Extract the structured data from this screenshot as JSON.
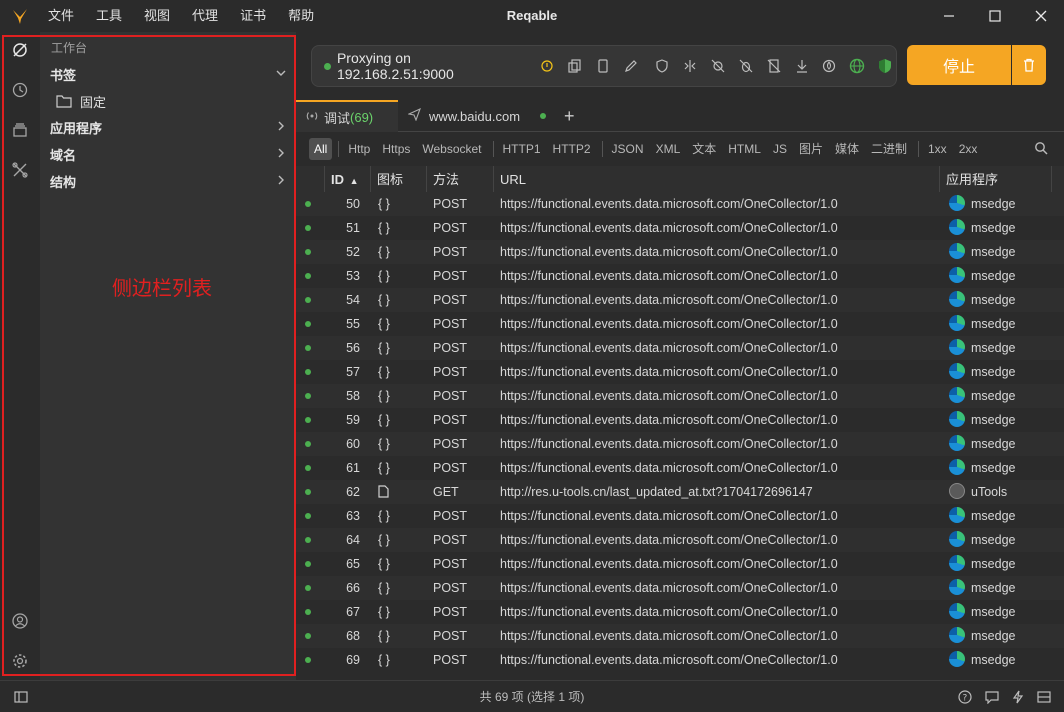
{
  "app": {
    "title": "Reqable"
  },
  "menu": [
    "文件",
    "工具",
    "视图",
    "代理",
    "证书",
    "帮助"
  ],
  "sidebar": {
    "title": "工作台",
    "bookmarks_label": "书签",
    "pinned_label": "固定",
    "apps_label": "应用程序",
    "domains_label": "域名",
    "structure_label": "结构"
  },
  "annotation": {
    "label": "侧边栏列表",
    "color": "#e02020"
  },
  "proxy": {
    "status": "Proxying on 192.168.2.51:9000",
    "stop_label": "停止",
    "accent": "#f5a623"
  },
  "tabs": [
    {
      "label": "调试",
      "count": "(69)"
    },
    {
      "label": "www.baidu.com"
    }
  ],
  "filters": [
    "All",
    "Http",
    "Https",
    "Websocket",
    "HTTP1",
    "HTTP2",
    "JSON",
    "XML",
    "文本",
    "HTML",
    "JS",
    "图片",
    "媒体",
    "二进制",
    "1xx",
    "2xx"
  ],
  "table": {
    "columns": {
      "id": "ID",
      "icon": "图标",
      "method": "方法",
      "url": "URL",
      "app": "应用程序"
    },
    "rows": [
      {
        "id": "50",
        "icon": "{ }",
        "method": "POST",
        "url": "https://functional.events.data.microsoft.com/OneCollector/1.0",
        "app": "msedge",
        "app_icon": "edge-icon"
      },
      {
        "id": "51",
        "icon": "{ }",
        "method": "POST",
        "url": "https://functional.events.data.microsoft.com/OneCollector/1.0",
        "app": "msedge",
        "app_icon": "edge-icon"
      },
      {
        "id": "52",
        "icon": "{ }",
        "method": "POST",
        "url": "https://functional.events.data.microsoft.com/OneCollector/1.0",
        "app": "msedge",
        "app_icon": "edge-icon"
      },
      {
        "id": "53",
        "icon": "{ }",
        "method": "POST",
        "url": "https://functional.events.data.microsoft.com/OneCollector/1.0",
        "app": "msedge",
        "app_icon": "edge-icon"
      },
      {
        "id": "54",
        "icon": "{ }",
        "method": "POST",
        "url": "https://functional.events.data.microsoft.com/OneCollector/1.0",
        "app": "msedge",
        "app_icon": "edge-icon"
      },
      {
        "id": "55",
        "icon": "{ }",
        "method": "POST",
        "url": "https://functional.events.data.microsoft.com/OneCollector/1.0",
        "app": "msedge",
        "app_icon": "edge-icon"
      },
      {
        "id": "56",
        "icon": "{ }",
        "method": "POST",
        "url": "https://functional.events.data.microsoft.com/OneCollector/1.0",
        "app": "msedge",
        "app_icon": "edge-icon"
      },
      {
        "id": "57",
        "icon": "{ }",
        "method": "POST",
        "url": "https://functional.events.data.microsoft.com/OneCollector/1.0",
        "app": "msedge",
        "app_icon": "edge-icon"
      },
      {
        "id": "58",
        "icon": "{ }",
        "method": "POST",
        "url": "https://functional.events.data.microsoft.com/OneCollector/1.0",
        "app": "msedge",
        "app_icon": "edge-icon"
      },
      {
        "id": "59",
        "icon": "{ }",
        "method": "POST",
        "url": "https://functional.events.data.microsoft.com/OneCollector/1.0",
        "app": "msedge",
        "app_icon": "edge-icon"
      },
      {
        "id": "60",
        "icon": "{ }",
        "method": "POST",
        "url": "https://functional.events.data.microsoft.com/OneCollector/1.0",
        "app": "msedge",
        "app_icon": "edge-icon"
      },
      {
        "id": "61",
        "icon": "{ }",
        "method": "POST",
        "url": "https://functional.events.data.microsoft.com/OneCollector/1.0",
        "app": "msedge",
        "app_icon": "edge-icon"
      },
      {
        "id": "62",
        "icon": "file",
        "method": "GET",
        "url": "http://res.u-tools.cn/last_updated_at.txt?1704172696147",
        "app": "uTools",
        "app_icon": "utools-icon"
      },
      {
        "id": "63",
        "icon": "{ }",
        "method": "POST",
        "url": "https://functional.events.data.microsoft.com/OneCollector/1.0",
        "app": "msedge",
        "app_icon": "edge-icon"
      },
      {
        "id": "64",
        "icon": "{ }",
        "method": "POST",
        "url": "https://functional.events.data.microsoft.com/OneCollector/1.0",
        "app": "msedge",
        "app_icon": "edge-icon"
      },
      {
        "id": "65",
        "icon": "{ }",
        "method": "POST",
        "url": "https://functional.events.data.microsoft.com/OneCollector/1.0",
        "app": "msedge",
        "app_icon": "edge-icon"
      },
      {
        "id": "66",
        "icon": "{ }",
        "method": "POST",
        "url": "https://functional.events.data.microsoft.com/OneCollector/1.0",
        "app": "msedge",
        "app_icon": "edge-icon"
      },
      {
        "id": "67",
        "icon": "{ }",
        "method": "POST",
        "url": "https://functional.events.data.microsoft.com/OneCollector/1.0",
        "app": "msedge",
        "app_icon": "edge-icon"
      },
      {
        "id": "68",
        "icon": "{ }",
        "method": "POST",
        "url": "https://functional.events.data.microsoft.com/OneCollector/1.0",
        "app": "msedge",
        "app_icon": "edge-icon"
      },
      {
        "id": "69",
        "icon": "{ }",
        "method": "POST",
        "url": "https://functional.events.data.microsoft.com/OneCollector/1.0",
        "app": "msedge",
        "app_icon": "edge-icon"
      }
    ]
  },
  "status": {
    "summary": "共 69 项  (选择 1 项)"
  }
}
